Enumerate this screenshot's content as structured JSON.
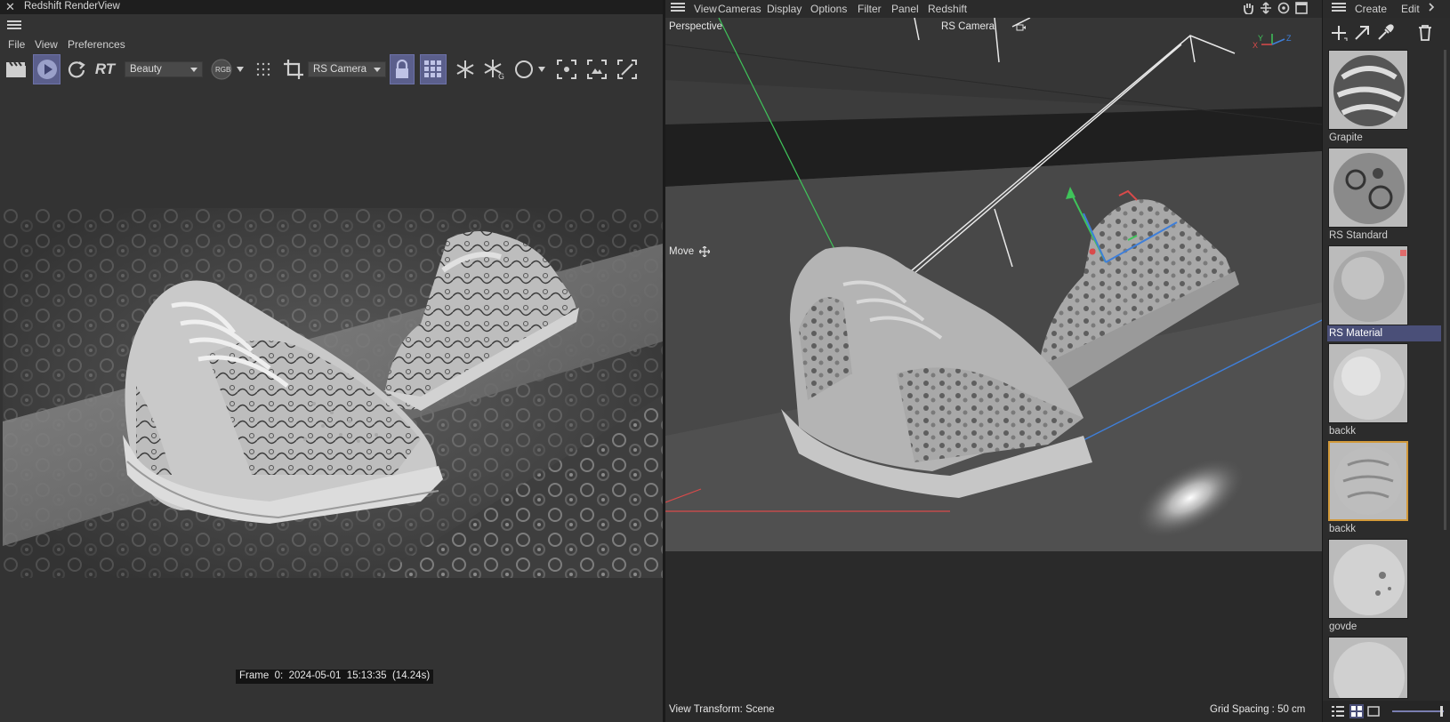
{
  "render_view": {
    "title": "Redshift RenderView",
    "close_glyph": "✕",
    "menu": [
      "File",
      "View",
      "Preferences"
    ],
    "toolbar": {
      "rt_label": "RT",
      "aov_select": "Beauty",
      "rgb_label": "RGB",
      "camera_select": "RS Camera"
    },
    "frame_info": "Frame  0:  2024-05-01  15:13:35  (14.24s)"
  },
  "viewport": {
    "menu": [
      "View",
      "Cameras",
      "Display",
      "Options",
      "Filter",
      "Panel",
      "Redshift"
    ],
    "view_name": "Perspective",
    "camera_name": "RS Camera",
    "tool_label": "Move",
    "view_transform": "View Transform: Scene",
    "grid_spacing": "Grid Spacing : 50 cm",
    "axis_labels": {
      "x": "X",
      "y": "Y",
      "z": "Z"
    }
  },
  "material_browser": {
    "menu": [
      "Create",
      "Edit"
    ],
    "materials": [
      {
        "name": "Grapite",
        "state": "normal"
      },
      {
        "name": "RS Standard",
        "state": "normal"
      },
      {
        "name": "RS Material",
        "state": "selected"
      },
      {
        "name": "backk",
        "state": "normal"
      },
      {
        "name": "backk",
        "state": "highlighted"
      },
      {
        "name": "govde",
        "state": "normal"
      },
      {
        "name": "",
        "state": "normal"
      }
    ]
  },
  "colors": {
    "accent_blue": "#5b5f8c",
    "selection_orange": "#d39a3a",
    "axis_x": "#d94a4a",
    "axis_y": "#3fc45a",
    "axis_z": "#3f7fd9"
  }
}
